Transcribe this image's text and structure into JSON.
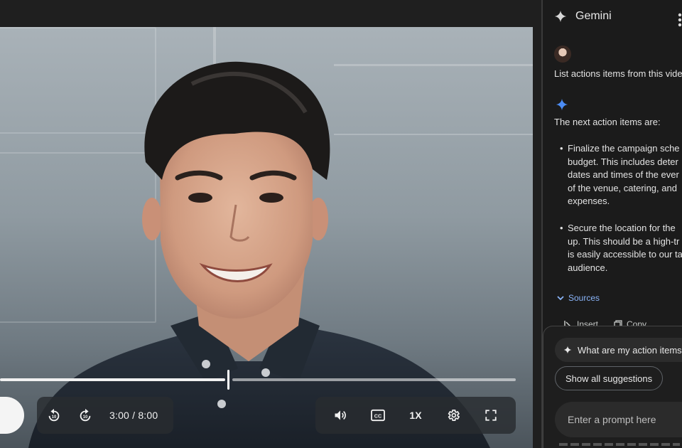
{
  "player": {
    "time_display": "3:00 / 8:00",
    "current_time": "3:00",
    "duration": "8:00",
    "progress_fraction": 0.442,
    "rewind_seconds": "10",
    "forward_seconds": "10",
    "captions_label": "CC",
    "speed_label": "1X",
    "icons": {
      "rewind": "replay-10-icon",
      "forward": "forward-10-icon",
      "volume": "volume-icon",
      "captions": "closed-captions-icon",
      "settings": "gear-icon",
      "fullscreen": "fullscreen-icon"
    }
  },
  "gemini": {
    "title": "Gemini",
    "user_message": "List actions items from this vide",
    "response_intro": "The next action items are:",
    "bullets": [
      {
        "lines": [
          "Finalize the campaign sche",
          "budget. This includes deter",
          "dates and times of the ever",
          "of the venue, catering, and",
          "expenses."
        ]
      },
      {
        "lines": [
          "Secure the location for the",
          "up. This should be a high-tr",
          "is easily accessible to our ta",
          "audience."
        ]
      }
    ],
    "sources_label": "Sources",
    "insert_label": "Insert",
    "copy_label": "Copy",
    "suggestions": {
      "chip_primary": "What are my action items",
      "chip_show_all": "Show all suggestions"
    },
    "prompt_placeholder": "Enter a prompt here",
    "colors": {
      "accent": "#8ab4f8",
      "spark_blue": "#4c8df6"
    }
  }
}
